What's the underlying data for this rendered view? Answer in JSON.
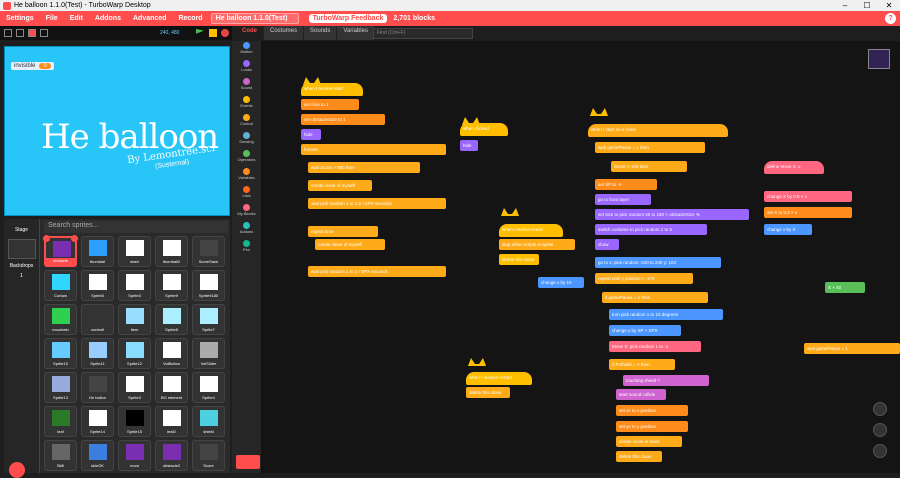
{
  "window": {
    "title": "He balloon 1.1.0(Test) - TurboWarp Desktop"
  },
  "menu": {
    "settings": "Settings",
    "file": "File",
    "edit": "Edit",
    "addons": "Addons",
    "advanced": "Advanced",
    "record": "Record",
    "project_name": "He balloon 1.1.0(Test)",
    "feedback": "TurboWarp Feedback",
    "blocks_count": "2,701 blocks",
    "help": "?"
  },
  "stage_controls": {
    "fps": "240, 480"
  },
  "stage": {
    "variable_label": "invisible",
    "variable_value": "0",
    "logo": "He balloon",
    "byline": "By Lemontree.sci",
    "byline2": "(Susternal)"
  },
  "sprites_pane": {
    "stage_label": "Stage",
    "backdrops_label": "Backdrops",
    "backdrops_count": "1",
    "search_placeholder": "Search sprites...",
    "sprites": [
      "obstacle",
      "thumbail",
      "dash",
      "thumbail2",
      "ScoreSave",
      "Curtain",
      "Sprite5",
      "Sprite3",
      "Sprite9",
      "Sprite9180",
      "mountain",
      "controll",
      "item",
      "Sprite8",
      "Sprite7",
      "Sprite10",
      "Sprite11",
      "Sprite12",
      "VolButton",
      "VolSlider",
      "Sprite13",
      "He ballon",
      "Sprite3",
      "BG element",
      "Sprite4",
      "leaf",
      "Sprite14",
      "Sprite15",
      "leaf2",
      "shield",
      "Skill",
      "skinOK",
      "nova",
      "obstacle2",
      "Score"
    ]
  },
  "editor": {
    "tabs": [
      "Code",
      "Costumes",
      "Sounds",
      "Variables"
    ],
    "find_placeholder": "Find (Ctrl+F)"
  },
  "categories": [
    {
      "label": "Motion",
      "color": "#4c97ff"
    },
    {
      "label": "Looks",
      "color": "#9966ff"
    },
    {
      "label": "Sound",
      "color": "#cf63cf"
    },
    {
      "label": "Events",
      "color": "#ffbf00"
    },
    {
      "label": "Control",
      "color": "#ffab19"
    },
    {
      "label": "Sensing",
      "color": "#5cb1d6"
    },
    {
      "label": "Operators",
      "color": "#59c059"
    },
    {
      "label": "Variables",
      "color": "#ff8c1a"
    },
    {
      "label": "Lists",
      "color": "#ff661a"
    },
    {
      "label": "My Blocks",
      "color": "#ff6680"
    },
    {
      "label": "Addons",
      "color": "#29beb8"
    },
    {
      "label": "Pen",
      "color": "#0fbd8c"
    }
  ],
  "scripts": {
    "s1": [
      "when I receive start",
      "set time to 1",
      "set obstacleSize to 1",
      "hide",
      "forever",
      "wait Score > 950 then",
      "create clone of myself",
      "wait pick random 1 to 1.5 / SPX seconds",
      "repeat time",
      "create clone of myself",
      "wait pick random 1 to 2 / SPX seconds"
    ],
    "s2": [
      "when clicked",
      "hide"
    ],
    "s3": [
      "when I receive leave",
      "stop other scripts in sprite",
      "delete this clone"
    ],
    "s4": [
      "change x by 10"
    ],
    "s5": [
      "when I receive restart",
      "delete this clone"
    ],
    "s6": [
      "when I start as a clone",
      "wait gamePause = 1 then",
      "Score > 100 then",
      "set SP to -4",
      "go to front layer",
      "set size to pick random 50 to 150 × obstacleSize %",
      "switch costume to pick random 1 to 5",
      "show",
      "go to x: pick random -240 to 240 y: 104",
      "repeat until y position < -175",
      "if gamePause = 1 then",
      "turn pick random 1 to 10 degrees",
      "change y by SP + SPX",
      "Move X: pick random 1 to -1",
      "if P.Shield = Y then",
      "touching shield ?",
      "start sound collide",
      "set xc to x position",
      "set yc to y position",
      "create clone of dash",
      "delete this clone"
    ],
    "s7": [
      "define Move X: x",
      "change X by 0.9 × x",
      "set X to 0.9 × x",
      "change x by X"
    ],
    "s8": [
      "X × 40"
    ],
    "s9": [
      "wait gamePause = 1"
    ]
  }
}
